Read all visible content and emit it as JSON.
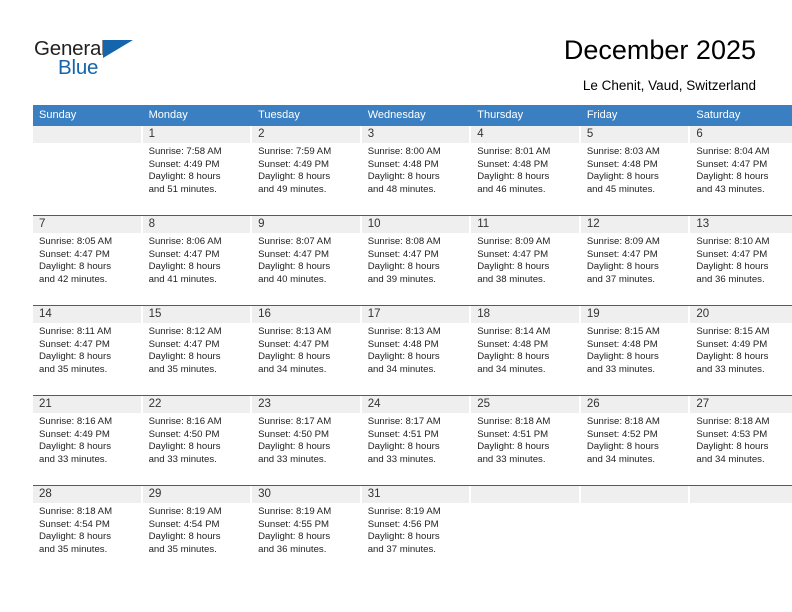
{
  "brand": {
    "name_top": "General",
    "name_bottom": "Blue",
    "accent_color": "#1565ad"
  },
  "header": {
    "title": "December 2025",
    "subtitle": "Le Chenit, Vaud, Switzerland",
    "header_bg_color": "#3a7fc1",
    "row_separator_color": "#1d68b3",
    "daynum_bg_color": "#efefef"
  },
  "weekday_headers": [
    "Sunday",
    "Monday",
    "Tuesday",
    "Wednesday",
    "Thursday",
    "Friday",
    "Saturday"
  ],
  "weeks": [
    [
      {
        "day": "",
        "sunrise": "",
        "sunset": "",
        "daylight_line1": "",
        "daylight_line2": ""
      },
      {
        "day": "1",
        "sunrise": "Sunrise: 7:58 AM",
        "sunset": "Sunset: 4:49 PM",
        "daylight_line1": "Daylight: 8 hours",
        "daylight_line2": "and 51 minutes."
      },
      {
        "day": "2",
        "sunrise": "Sunrise: 7:59 AM",
        "sunset": "Sunset: 4:49 PM",
        "daylight_line1": "Daylight: 8 hours",
        "daylight_line2": "and 49 minutes."
      },
      {
        "day": "3",
        "sunrise": "Sunrise: 8:00 AM",
        "sunset": "Sunset: 4:48 PM",
        "daylight_line1": "Daylight: 8 hours",
        "daylight_line2": "and 48 minutes."
      },
      {
        "day": "4",
        "sunrise": "Sunrise: 8:01 AM",
        "sunset": "Sunset: 4:48 PM",
        "daylight_line1": "Daylight: 8 hours",
        "daylight_line2": "and 46 minutes."
      },
      {
        "day": "5",
        "sunrise": "Sunrise: 8:03 AM",
        "sunset": "Sunset: 4:48 PM",
        "daylight_line1": "Daylight: 8 hours",
        "daylight_line2": "and 45 minutes."
      },
      {
        "day": "6",
        "sunrise": "Sunrise: 8:04 AM",
        "sunset": "Sunset: 4:47 PM",
        "daylight_line1": "Daylight: 8 hours",
        "daylight_line2": "and 43 minutes."
      }
    ],
    [
      {
        "day": "7",
        "sunrise": "Sunrise: 8:05 AM",
        "sunset": "Sunset: 4:47 PM",
        "daylight_line1": "Daylight: 8 hours",
        "daylight_line2": "and 42 minutes."
      },
      {
        "day": "8",
        "sunrise": "Sunrise: 8:06 AM",
        "sunset": "Sunset: 4:47 PM",
        "daylight_line1": "Daylight: 8 hours",
        "daylight_line2": "and 41 minutes."
      },
      {
        "day": "9",
        "sunrise": "Sunrise: 8:07 AM",
        "sunset": "Sunset: 4:47 PM",
        "daylight_line1": "Daylight: 8 hours",
        "daylight_line2": "and 40 minutes."
      },
      {
        "day": "10",
        "sunrise": "Sunrise: 8:08 AM",
        "sunset": "Sunset: 4:47 PM",
        "daylight_line1": "Daylight: 8 hours",
        "daylight_line2": "and 39 minutes."
      },
      {
        "day": "11",
        "sunrise": "Sunrise: 8:09 AM",
        "sunset": "Sunset: 4:47 PM",
        "daylight_line1": "Daylight: 8 hours",
        "daylight_line2": "and 38 minutes."
      },
      {
        "day": "12",
        "sunrise": "Sunrise: 8:09 AM",
        "sunset": "Sunset: 4:47 PM",
        "daylight_line1": "Daylight: 8 hours",
        "daylight_line2": "and 37 minutes."
      },
      {
        "day": "13",
        "sunrise": "Sunrise: 8:10 AM",
        "sunset": "Sunset: 4:47 PM",
        "daylight_line1": "Daylight: 8 hours",
        "daylight_line2": "and 36 minutes."
      }
    ],
    [
      {
        "day": "14",
        "sunrise": "Sunrise: 8:11 AM",
        "sunset": "Sunset: 4:47 PM",
        "daylight_line1": "Daylight: 8 hours",
        "daylight_line2": "and 35 minutes."
      },
      {
        "day": "15",
        "sunrise": "Sunrise: 8:12 AM",
        "sunset": "Sunset: 4:47 PM",
        "daylight_line1": "Daylight: 8 hours",
        "daylight_line2": "and 35 minutes."
      },
      {
        "day": "16",
        "sunrise": "Sunrise: 8:13 AM",
        "sunset": "Sunset: 4:47 PM",
        "daylight_line1": "Daylight: 8 hours",
        "daylight_line2": "and 34 minutes."
      },
      {
        "day": "17",
        "sunrise": "Sunrise: 8:13 AM",
        "sunset": "Sunset: 4:48 PM",
        "daylight_line1": "Daylight: 8 hours",
        "daylight_line2": "and 34 minutes."
      },
      {
        "day": "18",
        "sunrise": "Sunrise: 8:14 AM",
        "sunset": "Sunset: 4:48 PM",
        "daylight_line1": "Daylight: 8 hours",
        "daylight_line2": "and 34 minutes."
      },
      {
        "day": "19",
        "sunrise": "Sunrise: 8:15 AM",
        "sunset": "Sunset: 4:48 PM",
        "daylight_line1": "Daylight: 8 hours",
        "daylight_line2": "and 33 minutes."
      },
      {
        "day": "20",
        "sunrise": "Sunrise: 8:15 AM",
        "sunset": "Sunset: 4:49 PM",
        "daylight_line1": "Daylight: 8 hours",
        "daylight_line2": "and 33 minutes."
      }
    ],
    [
      {
        "day": "21",
        "sunrise": "Sunrise: 8:16 AM",
        "sunset": "Sunset: 4:49 PM",
        "daylight_line1": "Daylight: 8 hours",
        "daylight_line2": "and 33 minutes."
      },
      {
        "day": "22",
        "sunrise": "Sunrise: 8:16 AM",
        "sunset": "Sunset: 4:50 PM",
        "daylight_line1": "Daylight: 8 hours",
        "daylight_line2": "and 33 minutes."
      },
      {
        "day": "23",
        "sunrise": "Sunrise: 8:17 AM",
        "sunset": "Sunset: 4:50 PM",
        "daylight_line1": "Daylight: 8 hours",
        "daylight_line2": "and 33 minutes."
      },
      {
        "day": "24",
        "sunrise": "Sunrise: 8:17 AM",
        "sunset": "Sunset: 4:51 PM",
        "daylight_line1": "Daylight: 8 hours",
        "daylight_line2": "and 33 minutes."
      },
      {
        "day": "25",
        "sunrise": "Sunrise: 8:18 AM",
        "sunset": "Sunset: 4:51 PM",
        "daylight_line1": "Daylight: 8 hours",
        "daylight_line2": "and 33 minutes."
      },
      {
        "day": "26",
        "sunrise": "Sunrise: 8:18 AM",
        "sunset": "Sunset: 4:52 PM",
        "daylight_line1": "Daylight: 8 hours",
        "daylight_line2": "and 34 minutes."
      },
      {
        "day": "27",
        "sunrise": "Sunrise: 8:18 AM",
        "sunset": "Sunset: 4:53 PM",
        "daylight_line1": "Daylight: 8 hours",
        "daylight_line2": "and 34 minutes."
      }
    ],
    [
      {
        "day": "28",
        "sunrise": "Sunrise: 8:18 AM",
        "sunset": "Sunset: 4:54 PM",
        "daylight_line1": "Daylight: 8 hours",
        "daylight_line2": "and 35 minutes."
      },
      {
        "day": "29",
        "sunrise": "Sunrise: 8:19 AM",
        "sunset": "Sunset: 4:54 PM",
        "daylight_line1": "Daylight: 8 hours",
        "daylight_line2": "and 35 minutes."
      },
      {
        "day": "30",
        "sunrise": "Sunrise: 8:19 AM",
        "sunset": "Sunset: 4:55 PM",
        "daylight_line1": "Daylight: 8 hours",
        "daylight_line2": "and 36 minutes."
      },
      {
        "day": "31",
        "sunrise": "Sunrise: 8:19 AM",
        "sunset": "Sunset: 4:56 PM",
        "daylight_line1": "Daylight: 8 hours",
        "daylight_line2": "and 37 minutes."
      },
      {
        "day": "",
        "sunrise": "",
        "sunset": "",
        "daylight_line1": "",
        "daylight_line2": ""
      },
      {
        "day": "",
        "sunrise": "",
        "sunset": "",
        "daylight_line1": "",
        "daylight_line2": ""
      },
      {
        "day": "",
        "sunrise": "",
        "sunset": "",
        "daylight_line1": "",
        "daylight_line2": ""
      }
    ]
  ]
}
